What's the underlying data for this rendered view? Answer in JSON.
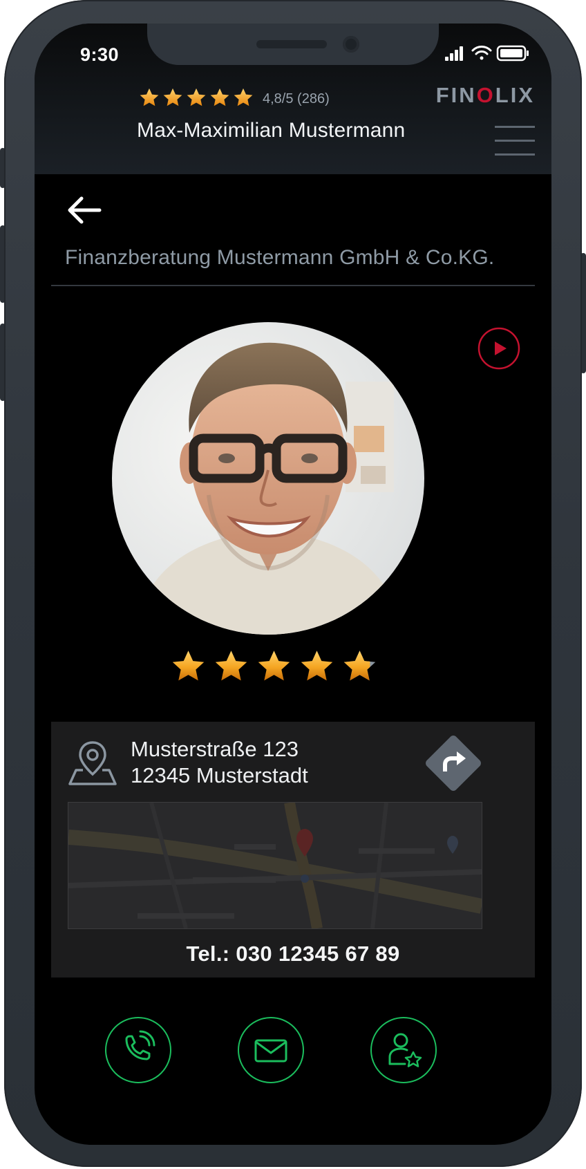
{
  "status_bar": {
    "time": "9:30"
  },
  "header": {
    "rating_value": "4,8/5 (286)",
    "rating_stars": 5,
    "advisor_name": "Max-Maximilian Mustermann",
    "brand_logo": {
      "prefix": "FIN",
      "accent": "O",
      "suffix": "LIX"
    }
  },
  "profile": {
    "company_name": "Finanzberatung Mustermann GmbH & Co.KG.",
    "photo": "portrait-photo",
    "rating_stars": 4.8
  },
  "contact": {
    "street": "Musterstraße 123",
    "city": "12345 Musterstadt",
    "phone": "Tel.: 030 12345 67 89"
  },
  "actions": [
    {
      "name": "call",
      "icon": "phone-icon"
    },
    {
      "name": "email",
      "icon": "mail-icon"
    },
    {
      "name": "favorite-advisor",
      "icon": "user-star-icon"
    }
  ],
  "colors": {
    "accent_red": "#c4122f",
    "action_green": "#1bbd5d",
    "star_orange": "#f5a623",
    "muted_text": "#8f9ba6"
  }
}
